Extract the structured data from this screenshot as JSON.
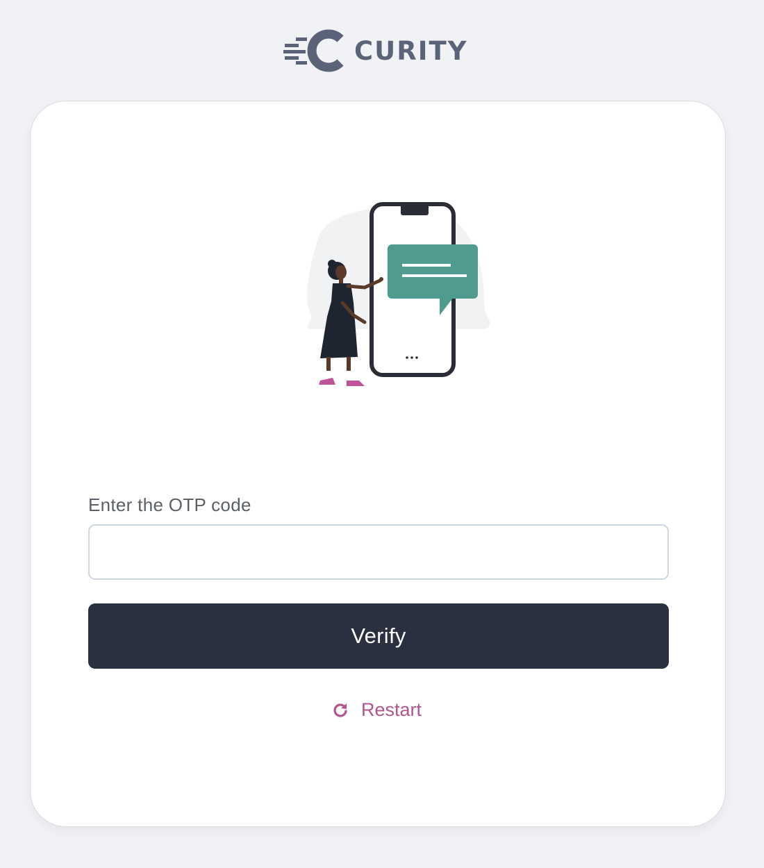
{
  "brand": {
    "name": "CURITY",
    "logo_icon": "curity-logo-icon",
    "text_color": "#5a6378"
  },
  "form": {
    "otp_label": "Enter the OTP code",
    "otp_value": "",
    "otp_placeholder": "",
    "verify_label": "Verify",
    "restart_label": "Restart",
    "restart_icon": "refresh-icon"
  },
  "colors": {
    "background": "#f0f2f5",
    "button": "#2a3040",
    "link": "#b2558e",
    "chat_bubble": "#4f9b8f"
  }
}
